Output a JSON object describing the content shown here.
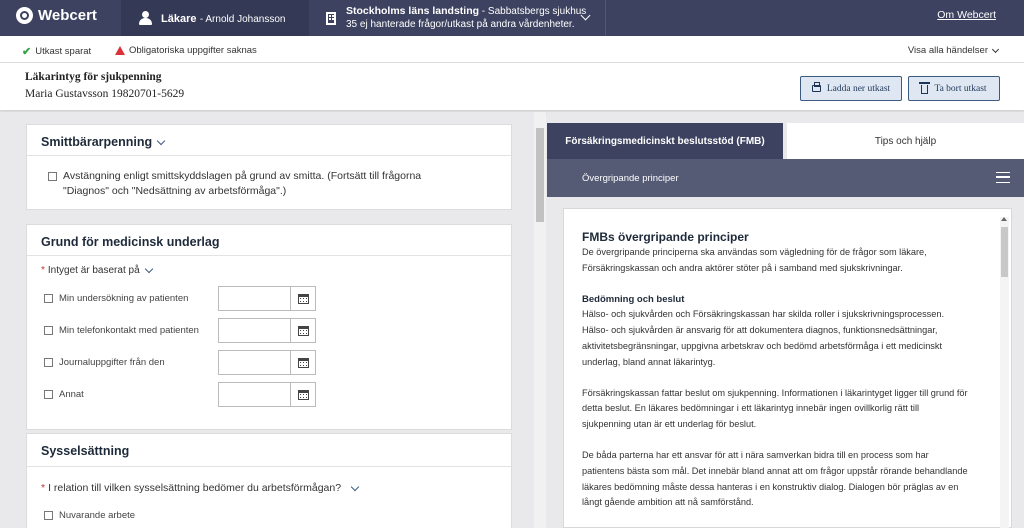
{
  "topbar": {
    "logo": "Webcert",
    "role": "Läkare",
    "user_name": "- Arnold Johansson",
    "unit_name": "Stockholms läns landsting",
    "unit_sub": " - Sabbatsbergs sjukhus",
    "unit_line2": "35 ej hanterade frågor/utkast på andra vårdenheter.",
    "about": "Om Webcert"
  },
  "statusbar": {
    "saved": "Utkast sparat",
    "missing": "Obligatoriska uppgifter saknas",
    "show_all": "Visa alla händelser"
  },
  "cert": {
    "title": "Läkarintyg för sjukpenning",
    "patient": "Maria Gustavsson 19820701-5629",
    "download_label": "Ladda ner utkast",
    "delete_label": "Ta bort utkast"
  },
  "form": {
    "smitta": {
      "title": "Smittbärarpenning",
      "option_line1": "Avstängning enligt smittskyddslagen på grund av smitta. (Fortsätt till frågorna",
      "option_line2": "\"Diagnos\" och \"Nedsättning av arbetsförmåga\".)"
    },
    "grund": {
      "title": "Grund för medicinsk underlag",
      "question": "Intyget är baserat på",
      "options": [
        "Min undersökning av patienten",
        "Min telefonkontakt med patienten",
        "Journaluppgifter från den",
        "Annat"
      ]
    },
    "syssel": {
      "title": "Sysselsättning",
      "question": "I relation till vilken sysselsättning bedömer du arbetsförmågan?",
      "options": [
        "Nuvarande arbete"
      ]
    }
  },
  "fmb": {
    "tab_fmb": "Försäkringsmedicinskt beslutsstöd (FMB)",
    "tab_tips": "Tips och hjälp",
    "subbar": "Övergripande principer",
    "heading": "FMBs övergripande principer",
    "p1_l1": "De övergripande principerna ska användas som vägledning för de frågor som läkare,",
    "p1_l2": "Försäkringskassan och andra aktörer stöter på i samband med sjukskrivningar.",
    "h_bedomning": "Bedömning och beslut",
    "p2_l1": "Hälso- och sjukvården och Försäkringskassan har skilda roller i sjukskrivningsprocessen.",
    "p2_l2": "Hälso- och sjukvården är ansvarig för att dokumentera diagnos, funktionsnedsättningar,",
    "p2_l3": "aktivitetsbegränsningar, uppgivna arbetskrav och bedömd arbetsförmåga i ett medicinskt",
    "p2_l4": "underlag, bland annat läkarintyg.",
    "p3_l1": "Försäkringskassan fattar beslut om sjukpenning. Informationen i läkarintyget ligger till grund för",
    "p3_l2": "detta beslut. En läkares bedömningar i ett läkarintyg innebär ingen ovillkorlig rätt till",
    "p3_l3": "sjukpenning utan är ett underlag för beslut.",
    "p4_l1": "De båda parterna har ett ansvar för att i nära samverkan bidra till en process som har",
    "p4_l2": "patientens bästa som mål. Det innebär bland annat att om frågor uppstår rörande behandlande",
    "p4_l3": "läkares bedömning måste dessa hanteras i en konstruktiv dialog. Dialogen bör präglas av en",
    "p4_l4": "långt gående ambition att nå samförstånd."
  },
  "colors": {
    "nav": "#3d4260",
    "accent": "#3d5a80",
    "ok": "#37a44a",
    "error": "#d9333a"
  }
}
